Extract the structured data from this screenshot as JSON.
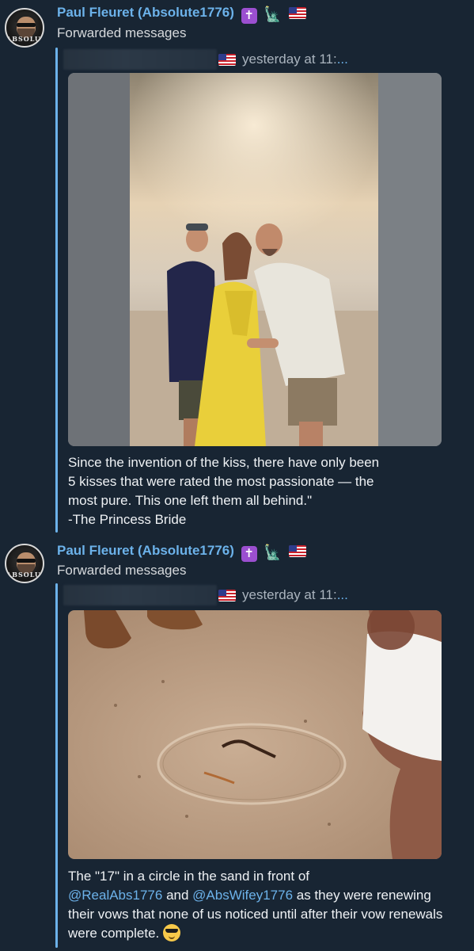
{
  "posts": [
    {
      "author": "Paul Fleuret (Absolute1776)",
      "author_emojis": [
        "latin-cross-icon",
        "statue-of-liberty-icon",
        "us-flag-icon"
      ],
      "forward_label": "Forwarded messages",
      "source_time": "yesterday at 11:",
      "source_time_ellipsis": "...",
      "photo_icon": "beach-kiss-photo",
      "caption_lines": [
        "Since the invention of the kiss, there have only been",
        "5 kisses that were rated the most passionate — the",
        "most pure. This one left them all behind.\"",
        "-The Princess Bride"
      ]
    },
    {
      "author": "Paul Fleuret (Absolute1776)",
      "author_emojis": [
        "latin-cross-icon",
        "statue-of-liberty-icon",
        "us-flag-icon"
      ],
      "forward_label": "Forwarded messages",
      "source_time": "yesterday at 11:",
      "source_time_ellipsis": "...",
      "photo_icon": "sand-circle-photo",
      "caption": {
        "part1": "The \"17\" in a circle in the sand in front of",
        "mention1": "@RealAbs1776",
        "part2": " and ",
        "mention2": "@AbsWifey1776",
        "part3": " as they were renewing their vows that none of us noticed until after their vow renewals were complete. ",
        "emoji": "smiling-face-with-sunglasses-icon"
      }
    }
  ],
  "avatar_text": "ABSOLUTE"
}
